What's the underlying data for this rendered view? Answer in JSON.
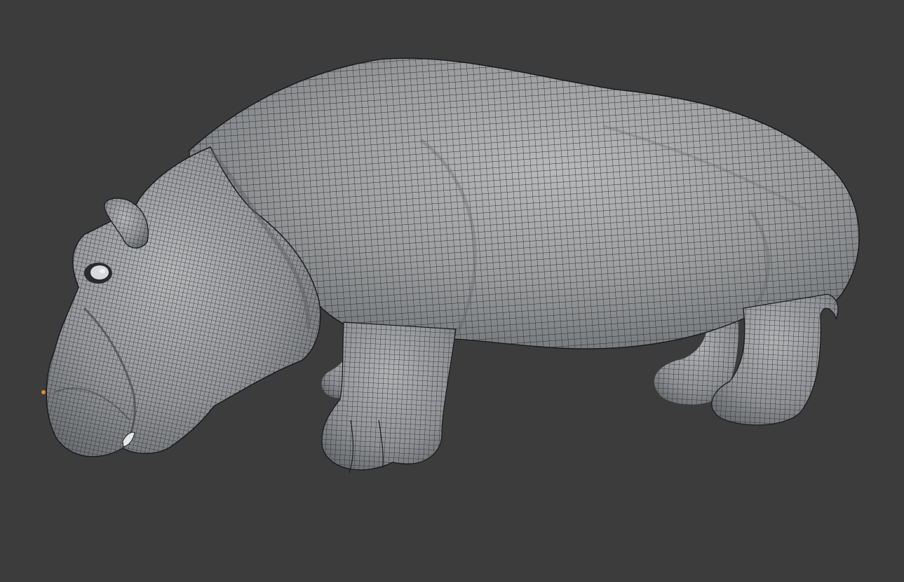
{
  "viewport": {
    "mode": "wireframe-on-shaded",
    "background_color": "#3c3c3c"
  },
  "model": {
    "subject": "hippopotamus",
    "surface_color": "#9a9c9e",
    "highlight_color": "#b7b9bb",
    "shadow_color": "#6e7173",
    "wire_color": "#1b1c1e",
    "eye_color": "#e6e6e6",
    "accent_color": "#e0863a"
  }
}
